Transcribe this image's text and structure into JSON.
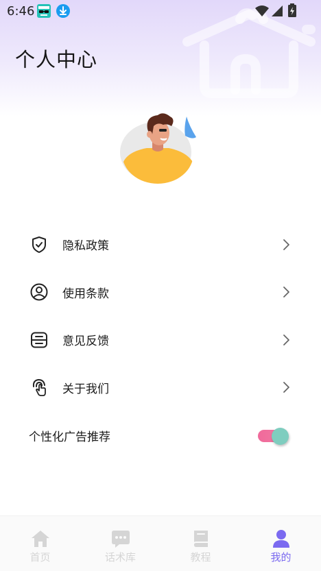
{
  "status_bar": {
    "time": "6:46",
    "icons": [
      "app-icon",
      "download-icon",
      "wifi-icon",
      "signal-icon",
      "battery-icon"
    ]
  },
  "header": {
    "title": "个人中心"
  },
  "menu": {
    "items": [
      {
        "label": "隐私政策",
        "icon": "shield-check-icon"
      },
      {
        "label": "使用条款",
        "icon": "user-circle-icon"
      },
      {
        "label": "意见反馈",
        "icon": "feedback-icon"
      },
      {
        "label": "关于我们",
        "icon": "touch-icon"
      }
    ]
  },
  "ad_setting": {
    "label": "个性化广告推荐",
    "enabled": true
  },
  "tab_bar": {
    "tabs": [
      {
        "label": "首页",
        "icon": "home-icon",
        "active": false
      },
      {
        "label": "话术库",
        "icon": "chat-icon",
        "active": false
      },
      {
        "label": "教程",
        "icon": "book-icon",
        "active": false
      },
      {
        "label": "我的",
        "icon": "person-icon",
        "active": true
      }
    ]
  },
  "colors": {
    "accent": "#7b6af0",
    "header_gradient_top": "#e2d8fa",
    "toggle_track": "#f06a9b",
    "toggle_thumb": "#7fcdbf",
    "inactive_tab": "#d5d5d5"
  }
}
